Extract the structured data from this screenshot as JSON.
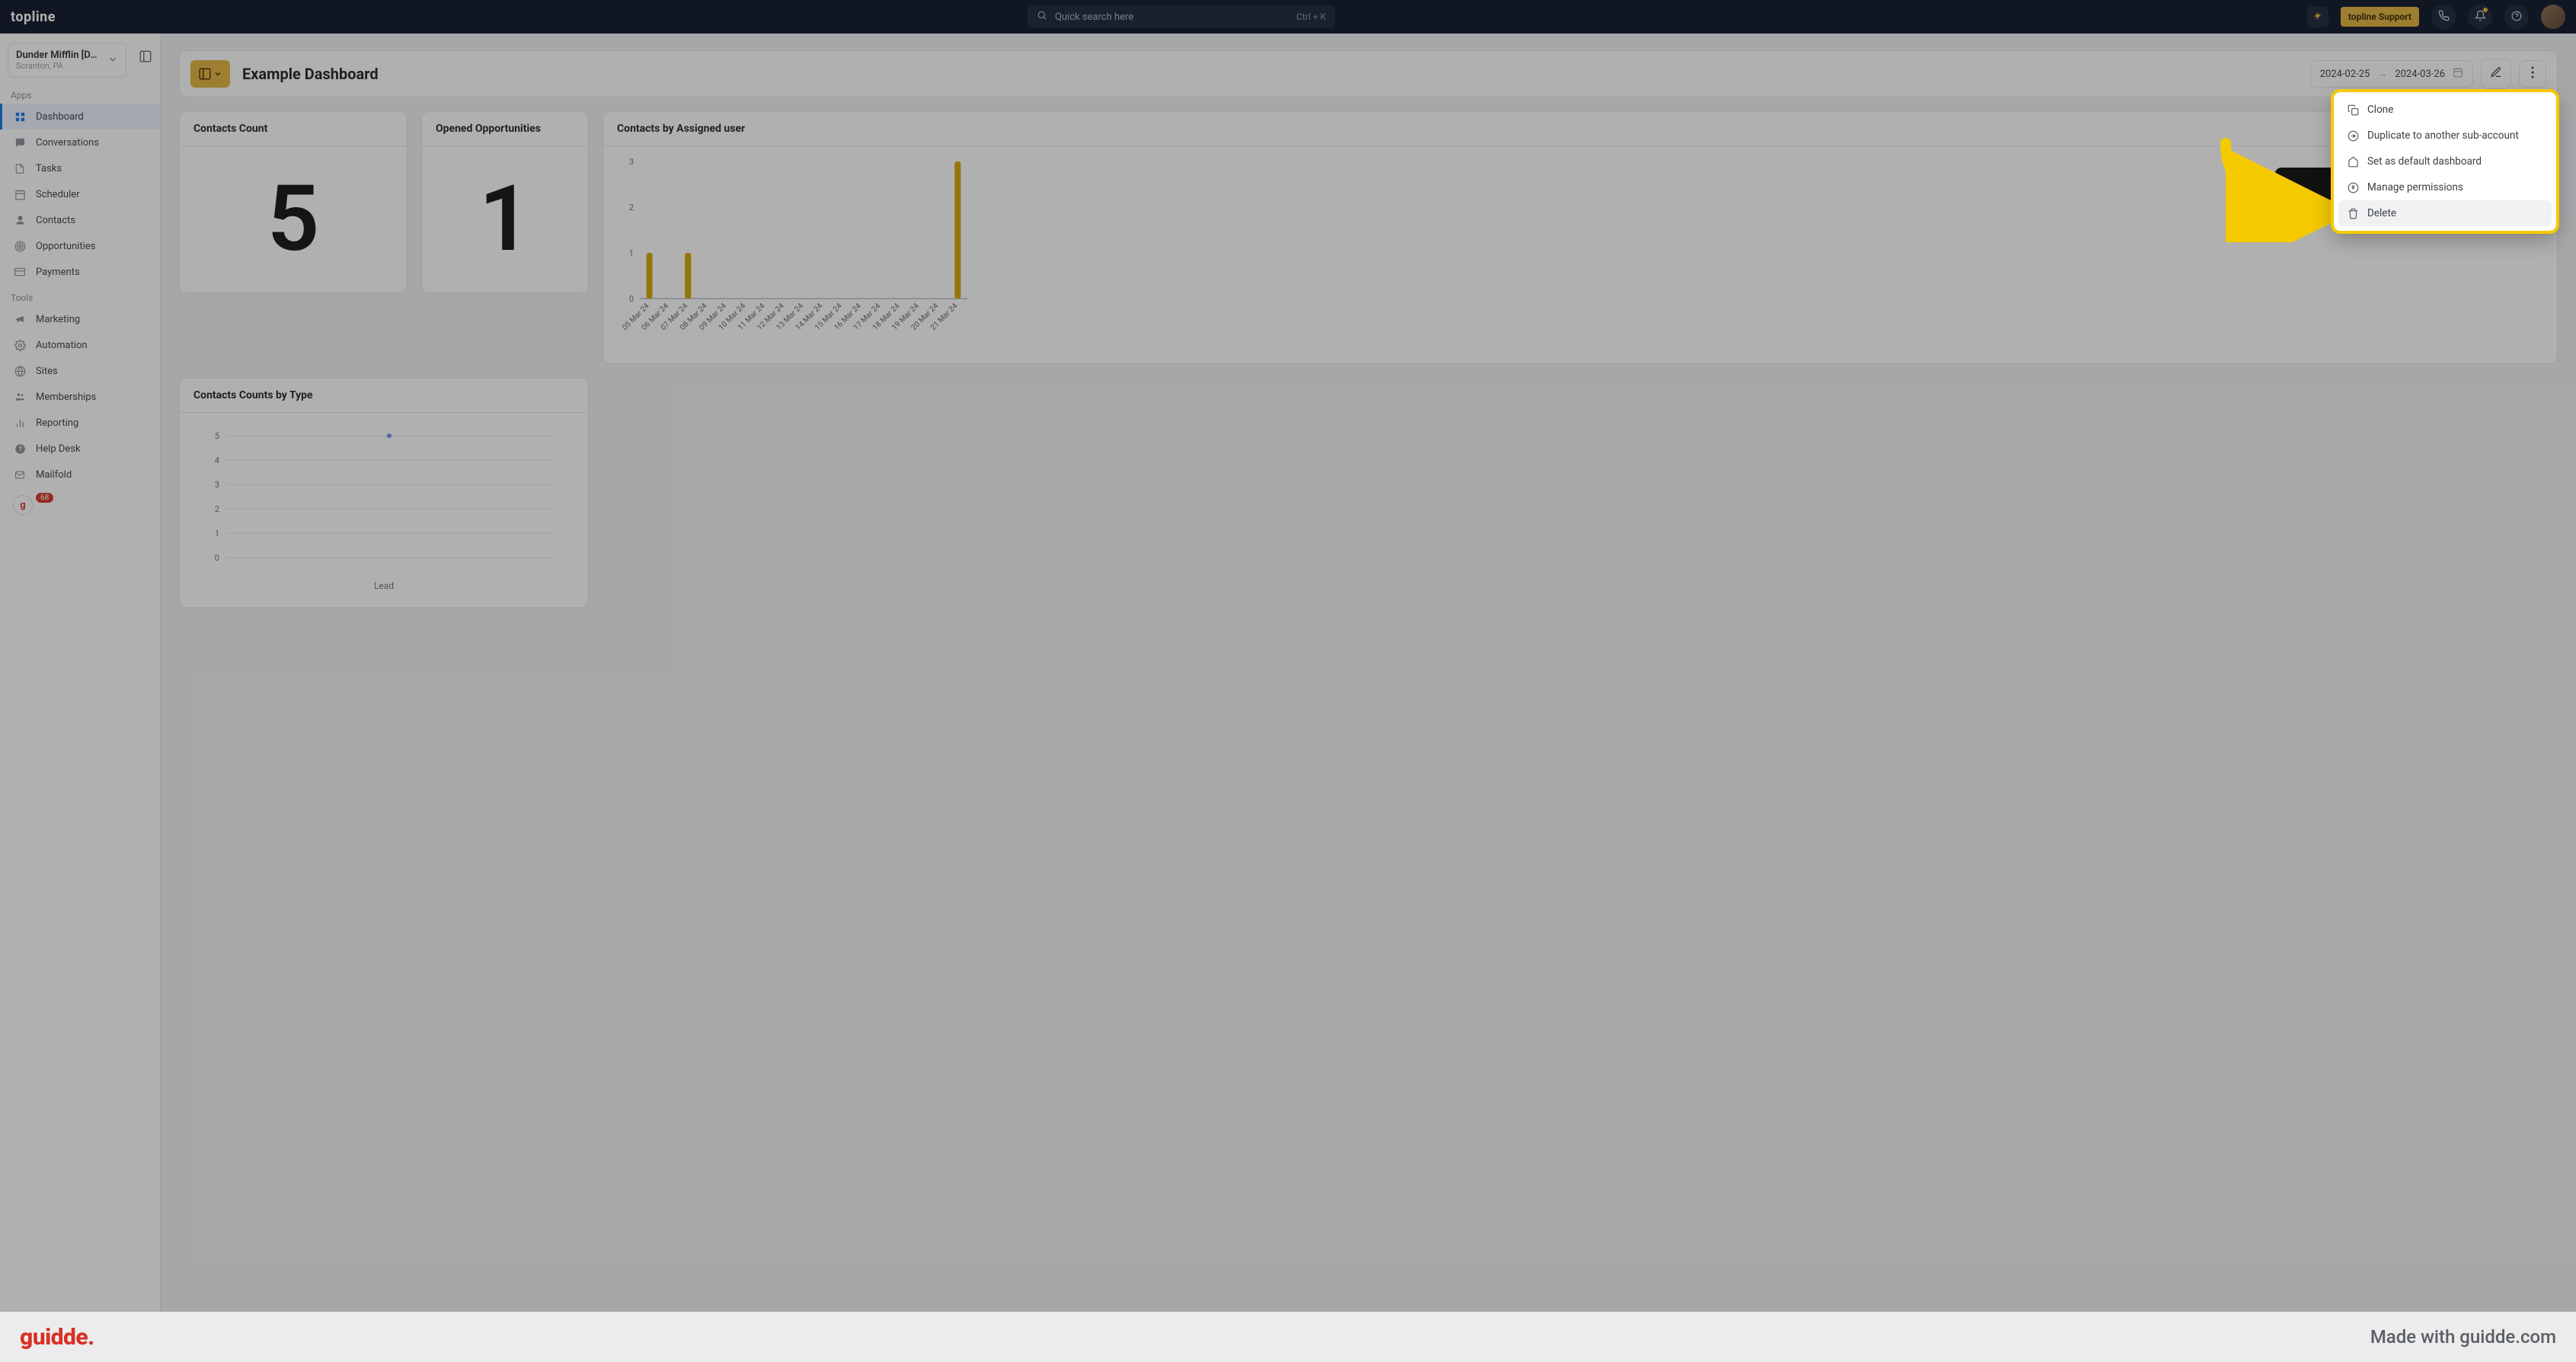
{
  "topbar": {
    "logo": "topline",
    "search_placeholder": "Quick search here",
    "search_shortcut": "Ctrl + K",
    "support_label": "topline Support"
  },
  "account": {
    "name": "Dunder Mifflin [D…",
    "location": "Scranton, PA"
  },
  "sections": {
    "apps": "Apps",
    "tools": "Tools"
  },
  "nav_apps": [
    {
      "label": "Dashboard",
      "icon": "grid-icon",
      "active": true
    },
    {
      "label": "Conversations",
      "icon": "chat-icon"
    },
    {
      "label": "Tasks",
      "icon": "doc-icon"
    },
    {
      "label": "Scheduler",
      "icon": "calendar-icon"
    },
    {
      "label": "Contacts",
      "icon": "person-icon"
    },
    {
      "label": "Opportunities",
      "icon": "target-icon"
    },
    {
      "label": "Payments",
      "icon": "card-icon"
    }
  ],
  "nav_tools": [
    {
      "label": "Marketing",
      "icon": "megaphone-icon"
    },
    {
      "label": "Automation",
      "icon": "gear-icon"
    },
    {
      "label": "Sites",
      "icon": "globe-icon"
    },
    {
      "label": "Memberships",
      "icon": "group-icon"
    },
    {
      "label": "Reporting",
      "icon": "report-icon"
    },
    {
      "label": "Help Desk",
      "icon": "help-icon"
    },
    {
      "label": "Mailfold",
      "icon": "mail-icon"
    }
  ],
  "last_item": {
    "badge": "68"
  },
  "page": {
    "title": "Example Dashboard",
    "date_start": "2024-02-25",
    "date_end": "2024-03-26"
  },
  "cards": {
    "contacts_count": {
      "title": "Contacts Count",
      "value": "5"
    },
    "opened_ops": {
      "title": "Opened Opportunities",
      "value": "1"
    },
    "by_assigned": {
      "title": "Contacts by Assigned user"
    },
    "by_type": {
      "title": "Contacts Counts by Type",
      "legend": "Lead"
    }
  },
  "chart_data": [
    {
      "id": "contacts_by_assigned_user",
      "type": "bar",
      "categories": [
        "05 Mar 24",
        "06 Mar 24",
        "07 Mar 24",
        "08 Mar 24",
        "09 Mar 24",
        "10 Mar 24",
        "11 Mar 24",
        "12 Mar 24",
        "13 Mar 24",
        "14 Mar 24",
        "15 Mar 24",
        "16 Mar 24",
        "17 Mar 24",
        "18 Mar 24",
        "19 Mar 24",
        "20 Mar 24",
        "21 Mar 24"
      ],
      "values": [
        1,
        0,
        1,
        0,
        0,
        0,
        0,
        0,
        0,
        0,
        0,
        0,
        0,
        0,
        0,
        0,
        3
      ],
      "ylim": [
        0,
        3
      ],
      "yticks": [
        0,
        1,
        2,
        3
      ],
      "bar_color": "#d6a400"
    },
    {
      "id": "contacts_counts_by_type",
      "type": "line",
      "series": [
        {
          "name": "Lead",
          "values": [
            5
          ]
        }
      ],
      "categories": [
        "Lead"
      ],
      "ylim": [
        0,
        5
      ],
      "yticks": [
        0,
        1,
        2,
        3,
        4,
        5
      ],
      "point_color": "#6f8bff"
    }
  ],
  "menu": {
    "items": [
      {
        "label": "Clone",
        "icon": "copy-icon"
      },
      {
        "label": "Duplicate to another sub-account",
        "icon": "export-icon"
      },
      {
        "label": "Set as default dashboard",
        "icon": "home-icon"
      },
      {
        "label": "Manage permissions",
        "icon": "lock-icon"
      },
      {
        "label": "Delete",
        "icon": "trash-icon",
        "highlight": true
      }
    ]
  },
  "footer": {
    "logo": "guidde.",
    "made_with": "Made with guidde.com"
  }
}
